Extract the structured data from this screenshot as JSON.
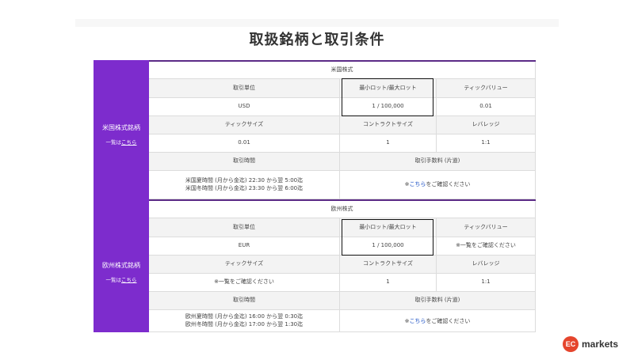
{
  "page": {
    "title": "取扱銘柄と取引条件"
  },
  "sections": [
    {
      "side_name": "米国株式銘柄",
      "side_sub_prefix": "一覧は",
      "side_sub_link": "こちら",
      "title": "米国株式",
      "h1": [
        "取引単位",
        "最小ロット/最大ロット",
        "ティックバリュー"
      ],
      "r1": [
        "USD",
        "1 / 100,000",
        "0.01"
      ],
      "h2": [
        "ティックサイズ",
        "コントラクトサイズ",
        "レバレッジ"
      ],
      "r2": [
        "0.01",
        "1",
        "1:1"
      ],
      "h3": [
        "取引時間",
        "取引手数料 (片道)"
      ],
      "hours": [
        "米国夏時間 (月から金迄) 22:30 から翌 5:00迄",
        "米国冬時間 (月から金迄) 23:30 から翌 6:00迄"
      ],
      "fee_mark": "※",
      "fee_link": "こちら",
      "fee_suffix": "をご確認ください"
    },
    {
      "side_name": "欧州株式銘柄",
      "side_sub_prefix": "一覧は",
      "side_sub_link": "こちら",
      "title": "欧州株式",
      "h1": [
        "取引単位",
        "最小ロット/最大ロット",
        "ティックバリュー"
      ],
      "r1": [
        "EUR",
        "1 / 100,000",
        "※一覧をご確認ください"
      ],
      "h2": [
        "ティックサイズ",
        "コントラクトサイズ",
        "レバレッジ"
      ],
      "r2": [
        "※一覧をご確認ください",
        "1",
        "1:1"
      ],
      "h3": [
        "取引時間",
        "取引手数料 (片道)"
      ],
      "hours": [
        "欧州夏時間 (月から金迄) 16:00 から翌 0:30迄",
        "欧州冬時間 (月から金迄) 17:00 から翌 1:30迄"
      ],
      "fee_mark": "※",
      "fee_link": "こちら",
      "fee_suffix": "をご確認ください"
    }
  ],
  "logo": {
    "mark": "EC",
    "text": "markets",
    "color": "#e5452d"
  },
  "colors": {
    "side_bg": "#7d2ccd",
    "header_bg": "#f3f3f3",
    "top_line": "#5b2a86",
    "link": "#1a4fc4"
  }
}
